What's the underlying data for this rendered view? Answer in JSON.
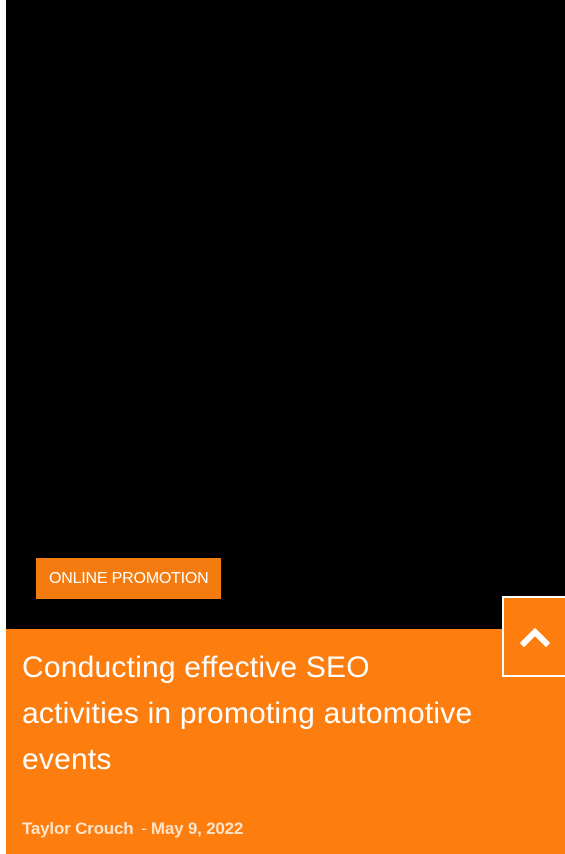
{
  "post": {
    "category": "ONLINE PROMOTION",
    "title": "Conducting effective SEO activities in promoting automotive events",
    "author": "Taylor Crouch",
    "separator": "-",
    "date": "May 9, 2022"
  },
  "scroll_top": {
    "icon": "chevron-up-icon"
  },
  "colors": {
    "image_area": "#000000",
    "accent": "#fd7d0e",
    "badge": "#f47b10",
    "title_text": "#ffffff",
    "meta_text": "#fde3c8"
  }
}
